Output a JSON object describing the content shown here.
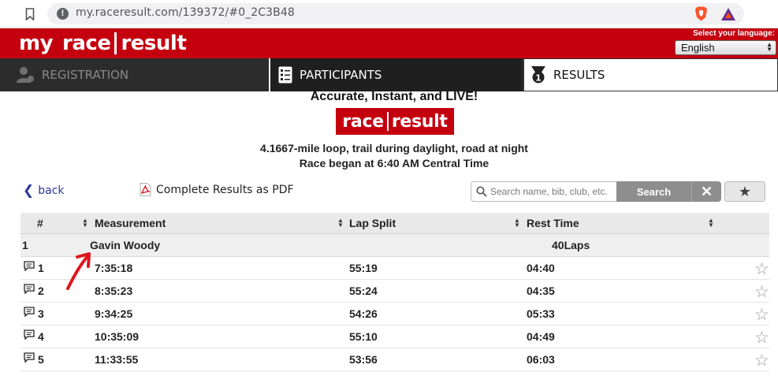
{
  "browser": {
    "url": "my.raceresult.com/139372/#0_2C3B48"
  },
  "header": {
    "logo": {
      "my": "my",
      "race": "race",
      "result": "result"
    },
    "language_label": "Select your language:",
    "language_value": "English"
  },
  "nav": {
    "tabs": [
      {
        "label": "REGISTRATION"
      },
      {
        "label": "PARTICIPANTS"
      },
      {
        "label": "RESULTS"
      }
    ]
  },
  "event": {
    "headline": "Accurate, Instant, and LIVE!",
    "logo": {
      "race": "race",
      "result": "result"
    },
    "subtitle1": "4.1667-mile loop, trail during daylight, road at night",
    "subtitle2": "Race began at 6:40 AM Central Time"
  },
  "toolbar": {
    "back_label": "back",
    "pdf_label": "Complete Results as PDF",
    "search_placeholder": "Search name, bib, club, etc.",
    "search_button": "Search",
    "clear_button": "✕",
    "favorite_button": "★"
  },
  "table": {
    "headers": [
      "#",
      "Measurement",
      "Lap Split",
      "Rest Time"
    ],
    "group": {
      "rank": "1",
      "name": "Gavin Woody",
      "laps": "40Laps"
    },
    "rows": [
      {
        "num": "1",
        "measurement": "7:35:18",
        "lap_split": "55:19",
        "rest_time": "04:40"
      },
      {
        "num": "2",
        "measurement": "8:35:23",
        "lap_split": "55:24",
        "rest_time": "04:35"
      },
      {
        "num": "3",
        "measurement": "9:34:25",
        "lap_split": "54:26",
        "rest_time": "05:33"
      },
      {
        "num": "4",
        "measurement": "10:35:09",
        "lap_split": "55:10",
        "rest_time": "04:49"
      },
      {
        "num": "5",
        "measurement": "11:33:55",
        "lap_split": "53:56",
        "rest_time": "06:03"
      }
    ]
  },
  "colors": {
    "brand_red": "#c4000f",
    "nav_dark": "#2c2c2c",
    "link_blue": "#2b3a9a",
    "annotation_red": "#e0141e"
  }
}
